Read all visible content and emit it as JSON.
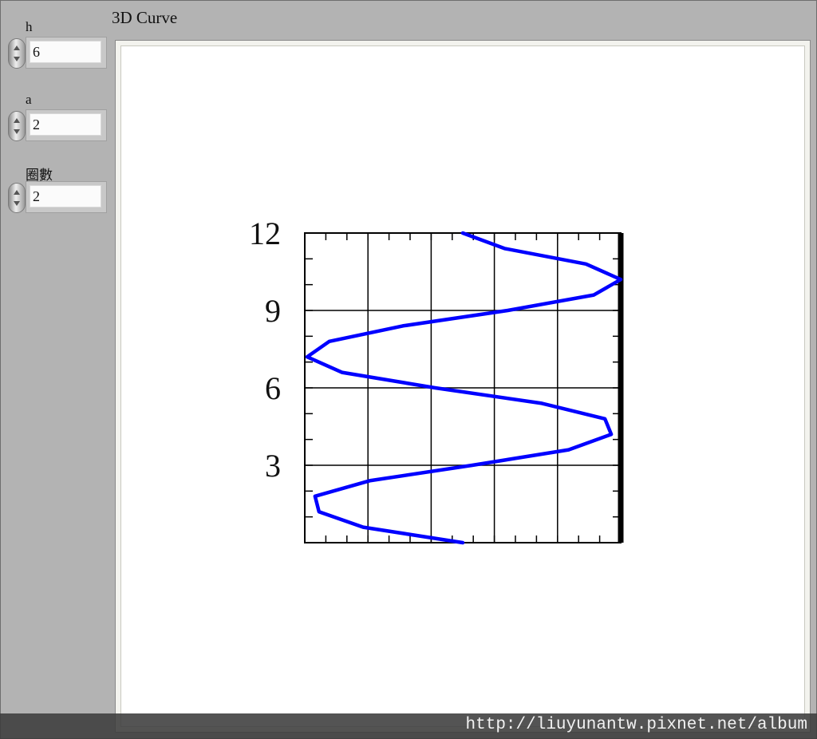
{
  "controls": [
    {
      "label": "h",
      "value": "6"
    },
    {
      "label": "a",
      "value": "2"
    },
    {
      "label": "圈數",
      "value": "2"
    }
  ],
  "chart": {
    "title": "3D Curve"
  },
  "chart_data": {
    "type": "line",
    "title": "3D Curve",
    "xlabel": "",
    "ylabel": "",
    "ylim": [
      0,
      12
    ],
    "xlim": [
      -2,
      2
    ],
    "yticks": [
      "3",
      "6",
      "9",
      "12"
    ],
    "grid": true,
    "series": [
      {
        "x": [
          0.0,
          -1.26,
          -1.82,
          -1.87,
          -1.18,
          0.12,
          1.34,
          1.88,
          1.8,
          1.0,
          -0.35,
          -1.53,
          -1.97,
          -1.69,
          -0.76,
          0.57,
          1.66,
          2.0,
          1.56,
          0.53,
          0.0
        ],
        "y": [
          0.0,
          0.6,
          1.2,
          1.8,
          2.4,
          3.0,
          3.6,
          4.2,
          4.8,
          5.4,
          6.0,
          6.6,
          7.2,
          7.8,
          8.4,
          9.0,
          9.6,
          10.2,
          10.8,
          11.4,
          12.0
        ],
        "color": "#0000ff"
      }
    ]
  },
  "watermark": "http://liuyunantw.pixnet.net/album"
}
